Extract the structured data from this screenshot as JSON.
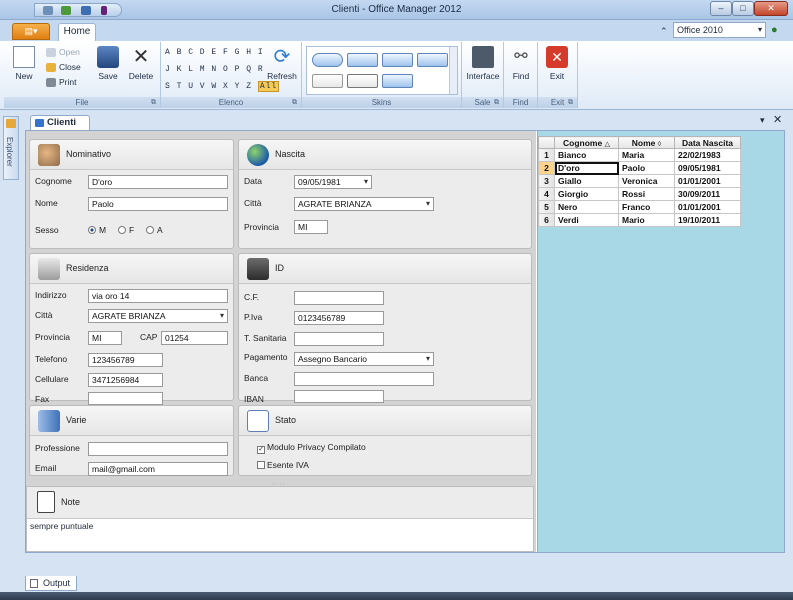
{
  "window": {
    "title": "Clienti - Office Manager 2012"
  },
  "ribbon": {
    "tabs": {
      "file": "",
      "home": "Home"
    },
    "theme": "Office 2010",
    "groups": {
      "file": {
        "label": "File",
        "new": "New",
        "open": "Open",
        "close": "Close",
        "print": "Print",
        "save": "Save",
        "delete": "Delete"
      },
      "elenco": {
        "label": "Elenco",
        "row1": "A B C D E F G H I",
        "row2": "J K L M N O P Q R",
        "row3": "S T U V W X Y Z",
        "all": "All",
        "refresh": "Refresh"
      },
      "skins": {
        "label": "Skins"
      },
      "sale": {
        "label": "Sale",
        "interface": "Interface"
      },
      "find": {
        "label": "Find",
        "find": "Find"
      },
      "exit": {
        "label": "Exit",
        "exit": "Exit"
      }
    }
  },
  "explorer": {
    "label": "Explorer"
  },
  "document": {
    "tab": "Clienti"
  },
  "form": {
    "nominativo": {
      "title": "Nominativo",
      "cognome_label": "Cognome",
      "cognome": "D'oro",
      "nome_label": "Nome",
      "nome": "Paolo",
      "sesso_label": "Sesso",
      "m": "M",
      "f": "F",
      "a": "A"
    },
    "nascita": {
      "title": "Nascita",
      "data_label": "Data",
      "data": "09/05/1981",
      "citta_label": "Città",
      "citta": "AGRATE BRIANZA",
      "provincia_label": "Provincia",
      "provincia": "MI"
    },
    "residenza": {
      "title": "Residenza",
      "indirizzo_label": "Indirizzo",
      "indirizzo": "via oro 14",
      "citta_label": "Città",
      "citta": "AGRATE BRIANZA",
      "provincia_label": "Provincia",
      "provincia": "MI",
      "cap_label": "CAP",
      "cap": "01254",
      "telefono_label": "Telefono",
      "telefono": "123456789",
      "cellulare_label": "Cellulare",
      "cellulare": "3471256984",
      "fax_label": "Fax",
      "fax": ""
    },
    "id": {
      "title": "ID",
      "cf_label": "C.F.",
      "cf": "",
      "piva_label": "P.Iva",
      "piva": "0123456789",
      "tsanitaria_label": "T. Sanitaria",
      "tsanitaria": "",
      "pagamento_label": "Pagamento",
      "pagamento": "Assegno Bancario",
      "banca_label": "Banca",
      "banca": "",
      "iban_label": "IBAN",
      "iban": ""
    },
    "varie": {
      "title": "Varie",
      "professione_label": "Professione",
      "professione": "",
      "email_label": "Email",
      "email": "mail@gmail.com"
    },
    "stato": {
      "title": "Stato",
      "privacy": "Modulo Privacy Compilato",
      "esente": "Esente IVA"
    },
    "note": {
      "title": "Note",
      "text": "sempre puntuale"
    }
  },
  "grid": {
    "headers": [
      "Cognome",
      "Nome",
      "Data Nascita"
    ],
    "rows": [
      {
        "n": "1",
        "cognome": "Bianco",
        "nome": "Maria",
        "data": "22/02/1983"
      },
      {
        "n": "2",
        "cognome": "D'oro",
        "nome": "Paolo",
        "data": "09/05/1981"
      },
      {
        "n": "3",
        "cognome": "Giallo",
        "nome": "Veronica",
        "data": "01/01/2001"
      },
      {
        "n": "4",
        "cognome": "Giorgio",
        "nome": "Rossi",
        "data": "30/09/2011"
      },
      {
        "n": "5",
        "cognome": "Nero",
        "nome": "Franco",
        "data": "01/01/2001"
      },
      {
        "n": "6",
        "cognome": "Verdi",
        "nome": "Mario",
        "data": "19/10/2011"
      }
    ]
  },
  "output": {
    "tab": "Output"
  },
  "colors": {
    "accent": "#f6cb55",
    "file_tab": "#e07f13",
    "grid_bg": "#a8d8e6"
  }
}
